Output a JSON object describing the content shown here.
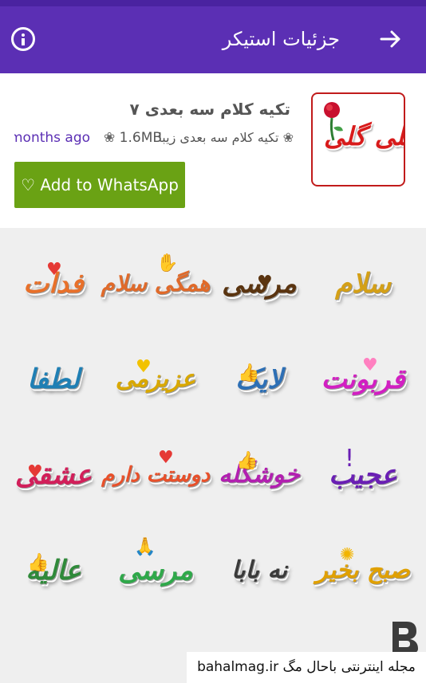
{
  "appbar": {
    "title": "جزئیات استیکر"
  },
  "pack": {
    "name": "تکیه کلام سه بعدی ۷",
    "thumbnail_text": "خیلی گلی",
    "author": "تکیه کلام سه بعدی زیبا",
    "size": "1.6MB",
    "updated": "months ago",
    "add_button": "♡ Add to WhatsApp"
  },
  "stickers": [
    "سلام",
    "مرسی",
    "همگی سلام",
    "فدات",
    "قربونت",
    "لایک",
    "عزیزمی",
    "لطفا",
    "عجیب",
    "خوشگله",
    "دوستت دارم",
    "عشقی",
    "صبح بخیر",
    "نه بابا",
    "مرسی",
    "عالیه"
  ],
  "watermark": {
    "text": "bahalmag.ir مجله اینترنتی باحال مگ"
  },
  "colors": {
    "appbar": "#5b2fb4",
    "button": "#6aa214",
    "accent": "#5b2fb4"
  }
}
